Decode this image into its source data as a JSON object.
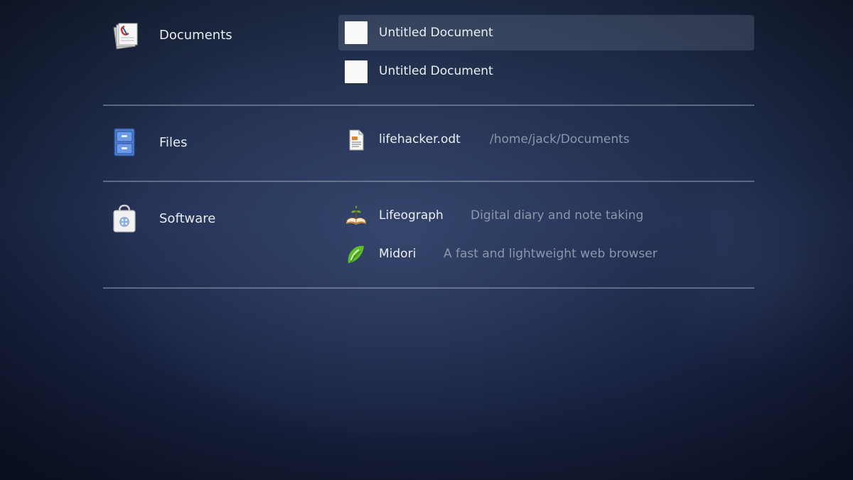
{
  "sections": [
    {
      "id": "documents",
      "label": "Documents",
      "icon": "documents-icon",
      "results": [
        {
          "title": "Untitled Document",
          "description": "",
          "icon": "blank-document-icon",
          "selected": true
        },
        {
          "title": "Untitled Document",
          "description": "",
          "icon": "blank-document-icon",
          "selected": false
        }
      ]
    },
    {
      "id": "files",
      "label": "Files",
      "icon": "file-cabinet-icon",
      "results": [
        {
          "title": "lifehacker.odt",
          "description": "/home/jack/Documents",
          "icon": "odt-file-icon"
        }
      ]
    },
    {
      "id": "software",
      "label": "Software",
      "icon": "software-bag-icon",
      "results": [
        {
          "title": "Lifeograph",
          "description": "Digital diary and note taking",
          "icon": "lifeograph-icon"
        },
        {
          "title": "Midori",
          "description": "A fast and lightweight web browser",
          "icon": "midori-icon"
        }
      ]
    }
  ],
  "colors": {
    "text": "#eceff4",
    "description": "#8d96aa",
    "divider": "#aab6cd",
    "selection": "#78849e"
  }
}
